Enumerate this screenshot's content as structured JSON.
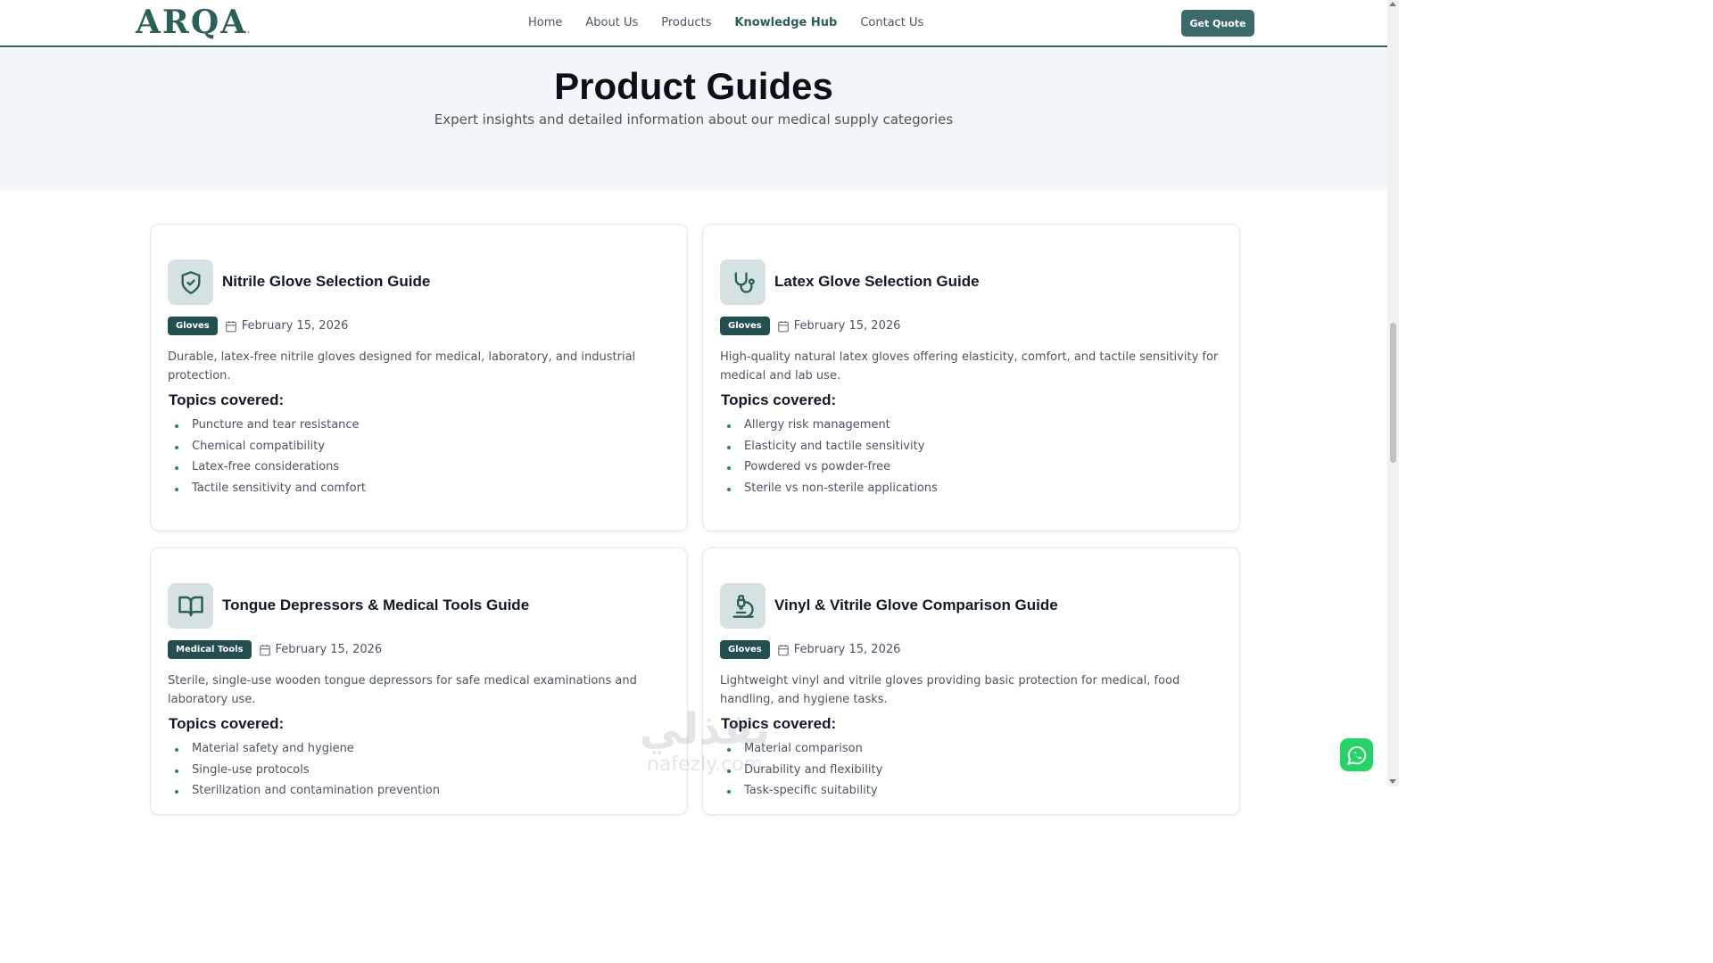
{
  "header": {
    "logo": "ARQA",
    "logo_mark": ".",
    "nav": [
      {
        "label": "Home"
      },
      {
        "label": "About Us"
      },
      {
        "label": "Products"
      },
      {
        "label": "Knowledge Hub",
        "active": true
      },
      {
        "label": "Contact Us"
      }
    ],
    "cta": "Get Quote"
  },
  "hero": {
    "title": "Product Guides",
    "subtitle": "Expert insights and detailed information about our medical supply categories"
  },
  "cards": [
    {
      "icon": "shield-check-icon",
      "title": "Nitrile Glove Selection Guide",
      "badge": "Gloves",
      "date": "February 15, 2026",
      "description": "Durable, latex-free nitrile gloves designed for medical, laboratory, and industrial protection.",
      "topics_heading": "Topics covered:",
      "topics": [
        "Puncture and tear resistance",
        "Chemical compatibility",
        "Latex-free considerations",
        "Tactile sensitivity and comfort"
      ]
    },
    {
      "icon": "stethoscope-icon",
      "title": "Latex Glove Selection Guide",
      "badge": "Gloves",
      "date": "February 15, 2026",
      "description": "High-quality natural latex gloves offering elasticity, comfort, and tactile sensitivity for medical and lab use.",
      "topics_heading": "Topics covered:",
      "topics": [
        "Allergy risk management",
        "Elasticity and tactile sensitivity",
        "Powdered vs powder-free",
        "Sterile vs non-sterile applications"
      ]
    },
    {
      "icon": "book-open-icon",
      "title": "Tongue Depressors & Medical Tools Guide",
      "badge": "Medical Tools",
      "date": "February 15, 2026",
      "description": "Sterile, single-use wooden tongue depressors for safe medical examinations and laboratory use.",
      "topics_heading": "Topics covered:",
      "topics": [
        "Material safety and hygiene",
        "Single-use protocols",
        "Sterilization and contamination prevention"
      ]
    },
    {
      "icon": "microscope-icon",
      "title": "Vinyl & Vitrile Glove Comparison Guide",
      "badge": "Gloves",
      "date": "February 15, 2026",
      "description": "Lightweight vinyl and vitrile gloves providing basic protection for medical, food handling, and hygiene tasks.",
      "topics_heading": "Topics covered:",
      "topics": [
        "Material comparison",
        "Durability and flexibility",
        "Task-specific suitability"
      ]
    }
  ],
  "watermark": {
    "arabic": "نفذلي",
    "latin": "nafezly.com"
  },
  "colors": {
    "brand": "#2c5f5a",
    "badge": "#244f51",
    "hero_bg": "#f3f6f9",
    "icon_bg": "#d6e1e2",
    "whatsapp": "#25d366"
  }
}
